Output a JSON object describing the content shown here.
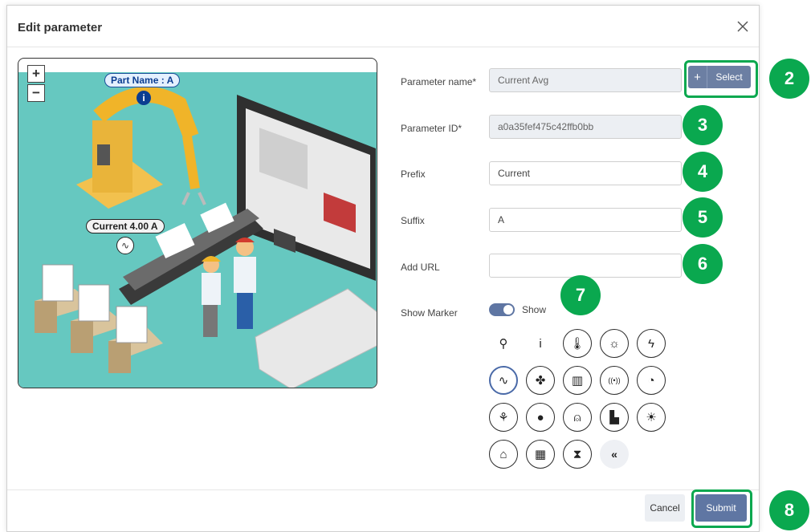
{
  "dialog": {
    "title": "Edit parameter"
  },
  "preview": {
    "zoom_in": "+",
    "zoom_out": "−",
    "part_label": "Part Name : A",
    "current_label": "Current 4.00 A"
  },
  "form": {
    "parameter_name": {
      "label": "Parameter name*",
      "value": "Current Avg"
    },
    "select_button": {
      "icon": "+",
      "label": "Select"
    },
    "parameter_id": {
      "label": "Parameter ID*",
      "value": "a0a35fef475c42ffb0bb"
    },
    "prefix": {
      "label": "Prefix",
      "value": "Current"
    },
    "suffix": {
      "label": "Suffix",
      "value": "A"
    },
    "add_url": {
      "label": "Add URL",
      "value": ""
    },
    "show_marker": {
      "label": "Show Marker",
      "toggle_text": "Show",
      "enabled": true
    }
  },
  "marker_icons": [
    {
      "name": "map-pin-icon",
      "glyph": "⚲"
    },
    {
      "name": "info-icon",
      "glyph": "i"
    },
    {
      "name": "thermometer-icon",
      "glyph": "🌡"
    },
    {
      "name": "sun-icon",
      "glyph": "☼"
    },
    {
      "name": "lightning-icon",
      "glyph": "ϟ"
    },
    {
      "name": "pulse-icon",
      "glyph": "∿",
      "selected": true
    },
    {
      "name": "fan-icon",
      "glyph": "✤"
    },
    {
      "name": "building-icon",
      "glyph": "▥"
    },
    {
      "name": "signal-icon",
      "glyph": "((•))"
    },
    {
      "name": "gauge-icon",
      "glyph": "◔"
    },
    {
      "name": "plant-icon",
      "glyph": "⚘"
    },
    {
      "name": "water-drop-icon",
      "glyph": "●"
    },
    {
      "name": "alarm-light-icon",
      "glyph": "⍝"
    },
    {
      "name": "factory-icon",
      "glyph": "▙"
    },
    {
      "name": "solar-panel-icon",
      "glyph": "☀"
    },
    {
      "name": "warehouse-icon",
      "glyph": "⌂"
    },
    {
      "name": "pallet-icon",
      "glyph": "▦"
    },
    {
      "name": "hourglass-icon",
      "glyph": "⧗"
    },
    {
      "name": "collapse-icon",
      "glyph": "«"
    }
  ],
  "footer": {
    "cancel": "Cancel",
    "submit": "Submit"
  },
  "callouts": [
    "2",
    "3",
    "4",
    "5",
    "6",
    "7",
    "8"
  ],
  "colors": {
    "accent": "#5f76a3",
    "callout": "#0aa84f",
    "scene_bg": "#66c8c0"
  }
}
